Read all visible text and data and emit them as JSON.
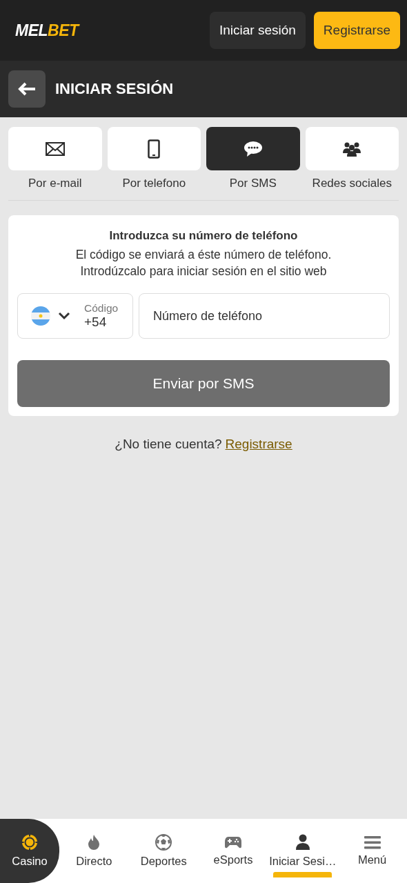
{
  "header": {
    "logo": [
      "MEL",
      "BET"
    ],
    "login_button": "Iniciar sesión",
    "register_button": "Registrarse"
  },
  "page_title": "INICIAR SESIÓN",
  "tabs": [
    {
      "kind": "email",
      "label": "Por e-mail",
      "selected": false
    },
    {
      "kind": "phone",
      "label": "Por telefono",
      "selected": false
    },
    {
      "kind": "sms",
      "label": "Por SMS",
      "selected": true
    },
    {
      "kind": "social",
      "label": "Redes sociales",
      "selected": false
    }
  ],
  "form": {
    "title": "Introduzca su número de teléfono",
    "description": [
      "El código se enviará a éste número de teléfono.",
      "Introdúzcalo para iniciar sesión en el sitio web"
    ],
    "code_label": "Código",
    "code_value": "+54",
    "phone_placeholder": "Número de teléfono",
    "submit_button": "Enviar por SMS"
  },
  "signup": {
    "question": "¿No tiene cuenta?",
    "link": "Registrarse"
  },
  "bottom_nav": [
    {
      "kind": "casino",
      "label": "Casino",
      "featured": true,
      "selected": false
    },
    {
      "kind": "fire",
      "label": "Directo",
      "featured": false,
      "selected": false
    },
    {
      "kind": "ball",
      "label": "Deportes",
      "featured": false,
      "selected": false
    },
    {
      "kind": "gamepad",
      "label": "eSports",
      "featured": false,
      "selected": false
    },
    {
      "kind": "user",
      "label": "Iniciar Sesi…",
      "featured": false,
      "selected": true
    },
    {
      "kind": "menu",
      "label": "Menú",
      "featured": false,
      "selected": false
    }
  ]
}
